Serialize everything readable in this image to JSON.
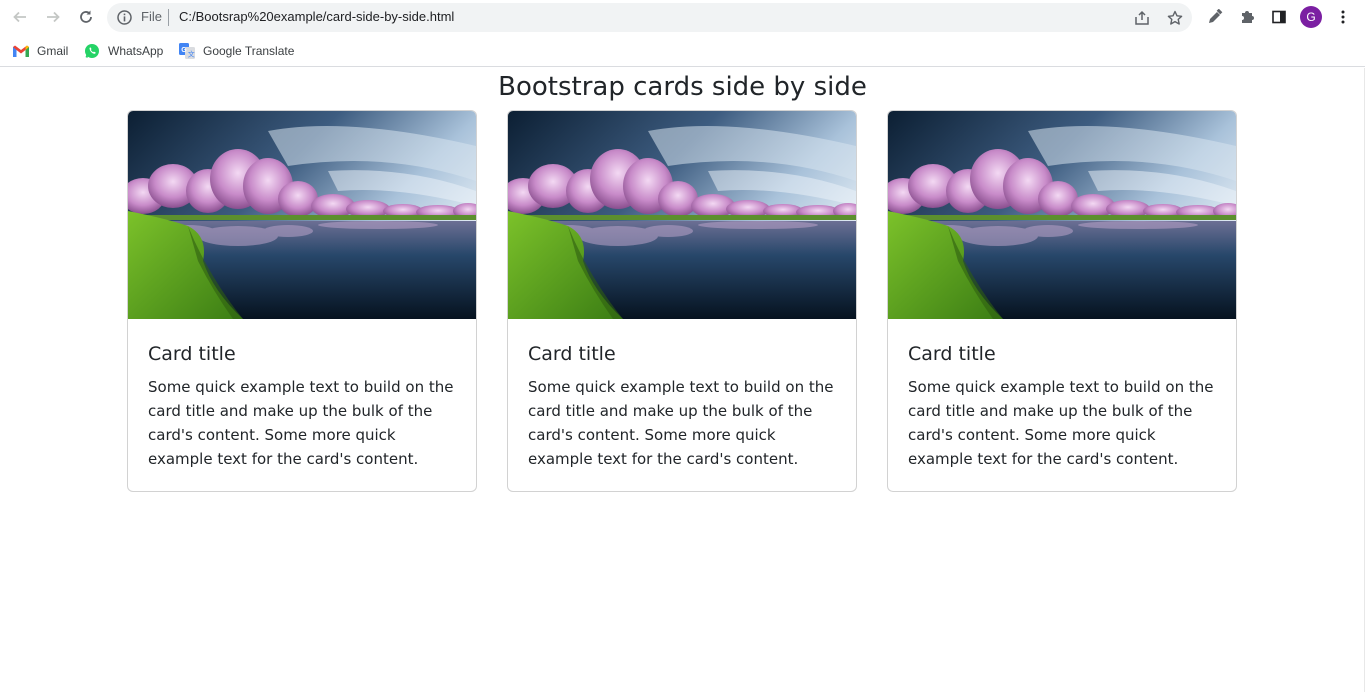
{
  "browser": {
    "url_scheme": "File",
    "url": "C:/Bootsrap%20example/card-side-by-side.html",
    "avatar_initial": "G",
    "avatar_color": "#7b1fa2",
    "bookmarks": [
      {
        "label": "Gmail",
        "icon": "gmail-icon"
      },
      {
        "label": "WhatsApp",
        "icon": "whatsapp-icon"
      },
      {
        "label": "Google Translate",
        "icon": "google-translate-icon"
      }
    ]
  },
  "page": {
    "title": "Bootstrap cards side by side",
    "cards": [
      {
        "image": "lake-trees-image",
        "title": "Card title",
        "text": "Some quick example text to build on the card title and make up the bulk of the card's content. Some more quick example text for the card's content."
      },
      {
        "image": "lake-trees-image",
        "title": "Card title",
        "text": "Some quick example text to build on the card title and make up the bulk of the card's content. Some more quick example text for the card's content."
      },
      {
        "image": "lake-trees-image",
        "title": "Card title",
        "text": "Some quick example text to build on the card title and make up the bulk of the card's content. Some more quick example text for the card's content."
      }
    ]
  }
}
